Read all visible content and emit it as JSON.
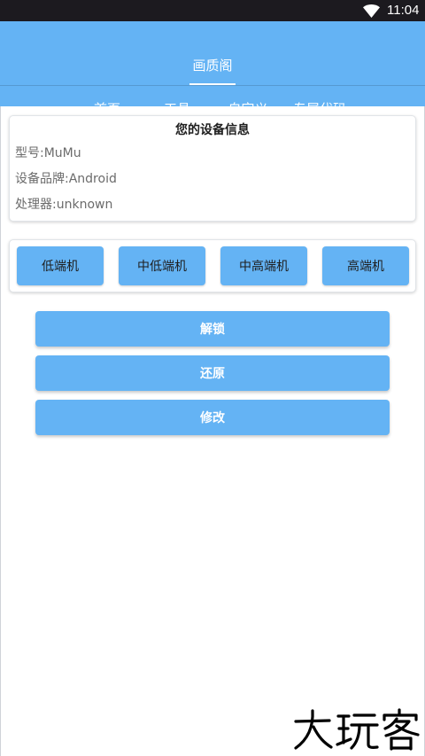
{
  "status_bar": {
    "time": "11:04",
    "wifi_icon": "wifi-icon"
  },
  "app_bar": {
    "title": "画质阁",
    "tabs": [
      {
        "label": "首页",
        "selected": true
      },
      {
        "label": "工具",
        "selected": false
      },
      {
        "label": "自定义",
        "selected": false
      },
      {
        "label": "专属代码",
        "selected": false
      }
    ]
  },
  "device_info": {
    "title": "您的设备信息",
    "rows": [
      "型号:MuMu",
      "设备品牌:Android",
      "处理器:unknown"
    ]
  },
  "tiers": [
    {
      "label": "低端机"
    },
    {
      "label": "中低端机"
    },
    {
      "label": "中高端机"
    },
    {
      "label": "高端机"
    }
  ],
  "actions": [
    {
      "label": "解锁"
    },
    {
      "label": "还原"
    },
    {
      "label": "修改"
    }
  ],
  "watermark": {
    "text": "大玩客"
  },
  "colors": {
    "primary": "#64b3f4",
    "status_bar": "#1c1a1f",
    "card_border": "#e1e4e8",
    "info_text": "#6b6b6b"
  }
}
